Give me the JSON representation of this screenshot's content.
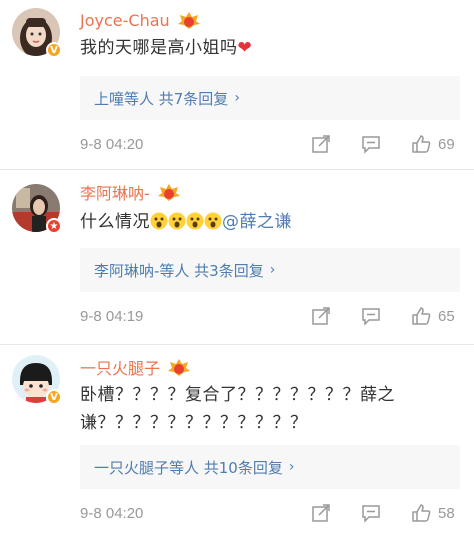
{
  "comments": [
    {
      "username": "Joyce-Chau",
      "text": "我的天哪是高小姐吗",
      "heart": "❤",
      "reply_summary": "上噇等人 共7条回复",
      "reply_chevron": "›",
      "time": "9-8 04:20",
      "likes": "69",
      "badge": "V"
    },
    {
      "username": "李阿琳呐-",
      "text_before": "什么情况",
      "mention": "@薛之谦",
      "reply_summary": "李阿琳呐-等人 共3条回复",
      "reply_chevron": "›",
      "time": "9-8 04:19",
      "likes": "65",
      "badge": "★"
    },
    {
      "username": "一只火腿子",
      "text_line1": "卧槽？？？？复合了？？？？？？？薛之",
      "text_line2": "谦？？？？？？？？？？？？",
      "reply_summary": "一只火腿子等人 共10条回复",
      "reply_chevron": "›",
      "time": "9-8 04:20",
      "likes": "58",
      "badge": "V"
    }
  ],
  "icons": {
    "share": "share-icon",
    "comment": "comment-icon",
    "like": "thumbs-up-icon",
    "fan_badge": "fan-badge-icon",
    "emoji": "shocked-emoji-icon"
  },
  "colors": {
    "username": "#eb7350",
    "link": "#507daf",
    "meta": "#999999",
    "reply_bg": "#f7f7f7"
  }
}
